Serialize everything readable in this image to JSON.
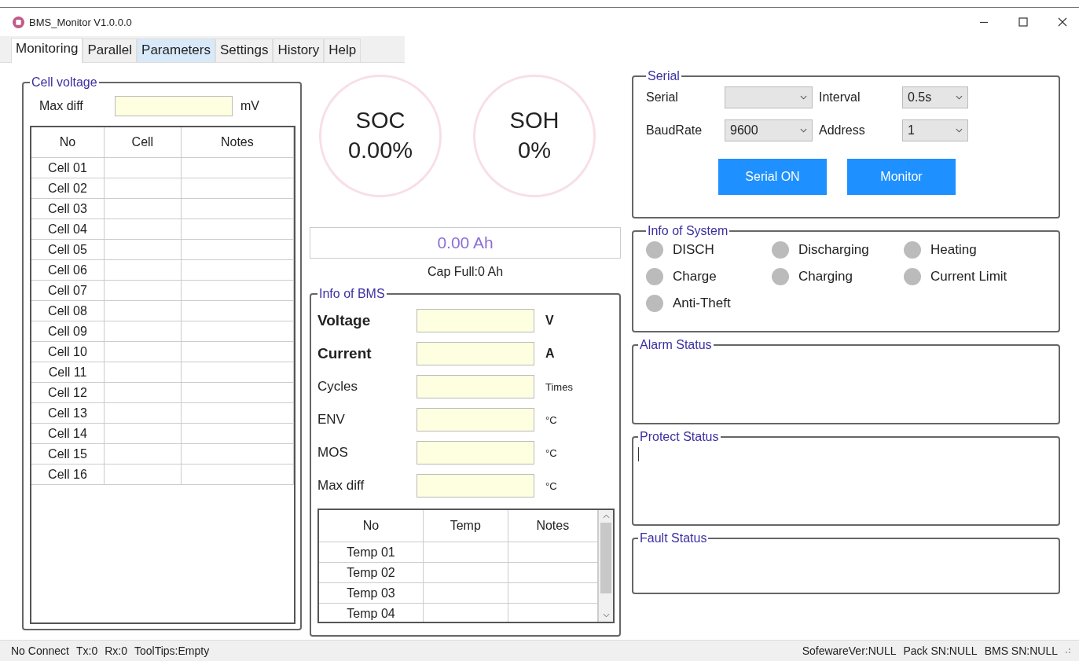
{
  "window": {
    "title": "BMS_Monitor V1.0.0.0"
  },
  "tabs": [
    {
      "label": "Monitoring",
      "selected": true,
      "hovered": false
    },
    {
      "label": "Parallel",
      "selected": false,
      "hovered": false
    },
    {
      "label": "Parameters",
      "selected": false,
      "hovered": true
    },
    {
      "label": "Settings",
      "selected": false,
      "hovered": false
    },
    {
      "label": "History",
      "selected": false,
      "hovered": false
    },
    {
      "label": "Help",
      "selected": false,
      "hovered": false
    }
  ],
  "cell_voltage": {
    "title": "Cell voltage",
    "max_diff": {
      "label": "Max diff",
      "unit": "mV"
    },
    "columns": [
      "No",
      "Cell",
      "Notes"
    ],
    "rows": [
      "Cell 01",
      "Cell 02",
      "Cell 03",
      "Cell 04",
      "Cell 05",
      "Cell 06",
      "Cell 07",
      "Cell 08",
      "Cell 09",
      "Cell 10",
      "Cell 11",
      "Cell 12",
      "Cell 13",
      "Cell 14",
      "Cell 15",
      "Cell 16"
    ]
  },
  "gauges": [
    {
      "label": "SOC",
      "value": "0.00%"
    },
    {
      "label": "SOH",
      "value": "0%"
    }
  ],
  "capacity": {
    "value": "0.00 Ah",
    "full": "Cap Full:0 Ah"
  },
  "bms_info": {
    "title": "Info of BMS",
    "fields": [
      {
        "label": "Voltage",
        "unit": "V",
        "bold": true
      },
      {
        "label": "Current",
        "unit": "A",
        "bold": true
      },
      {
        "label": "Cycles",
        "unit": "Times",
        "bold": false
      },
      {
        "label": "ENV",
        "unit": "°C",
        "bold": false
      },
      {
        "label": "MOS",
        "unit": "°C",
        "bold": false
      },
      {
        "label": "Max diff",
        "unit": "°C",
        "bold": false
      }
    ],
    "temp_table": {
      "columns": [
        "No",
        "Temp",
        "Notes"
      ],
      "rows": [
        "Temp 01",
        "Temp 02",
        "Temp 03",
        "Temp 04"
      ]
    }
  },
  "serial": {
    "title": "Serial",
    "fields": [
      {
        "label": "Serial"
      },
      {
        "label": "Interval",
        "value": "0.5s"
      },
      {
        "label": "BaudRate",
        "value": "9600"
      },
      {
        "label": "Address",
        "value": "1"
      }
    ],
    "buttons": [
      "Serial ON",
      "Monitor"
    ]
  },
  "system_info": {
    "title": "Info of System",
    "indicators": [
      {
        "label": "DISCH",
        "on": false
      },
      {
        "label": "Discharging",
        "on": false
      },
      {
        "label": "Heating",
        "on": false
      },
      {
        "label": "Charge",
        "on": false
      },
      {
        "label": "Charging",
        "on": false
      },
      {
        "label": "Current Limit",
        "on": false
      },
      {
        "label": "Anti-Theft",
        "on": false
      }
    ]
  },
  "status_panels": [
    {
      "title": "Alarm Status",
      "focused": false
    },
    {
      "title": "Protect Status",
      "focused": true
    },
    {
      "title": "Fault Status",
      "focused": false
    }
  ],
  "status_bar": {
    "left": [
      "No Connect",
      "Tx:0",
      "Rx:0",
      "ToolTips:Empty"
    ],
    "right": [
      "SofewareVer:NULL",
      "Pack SN:NULL",
      "BMS SN:NULL"
    ]
  }
}
